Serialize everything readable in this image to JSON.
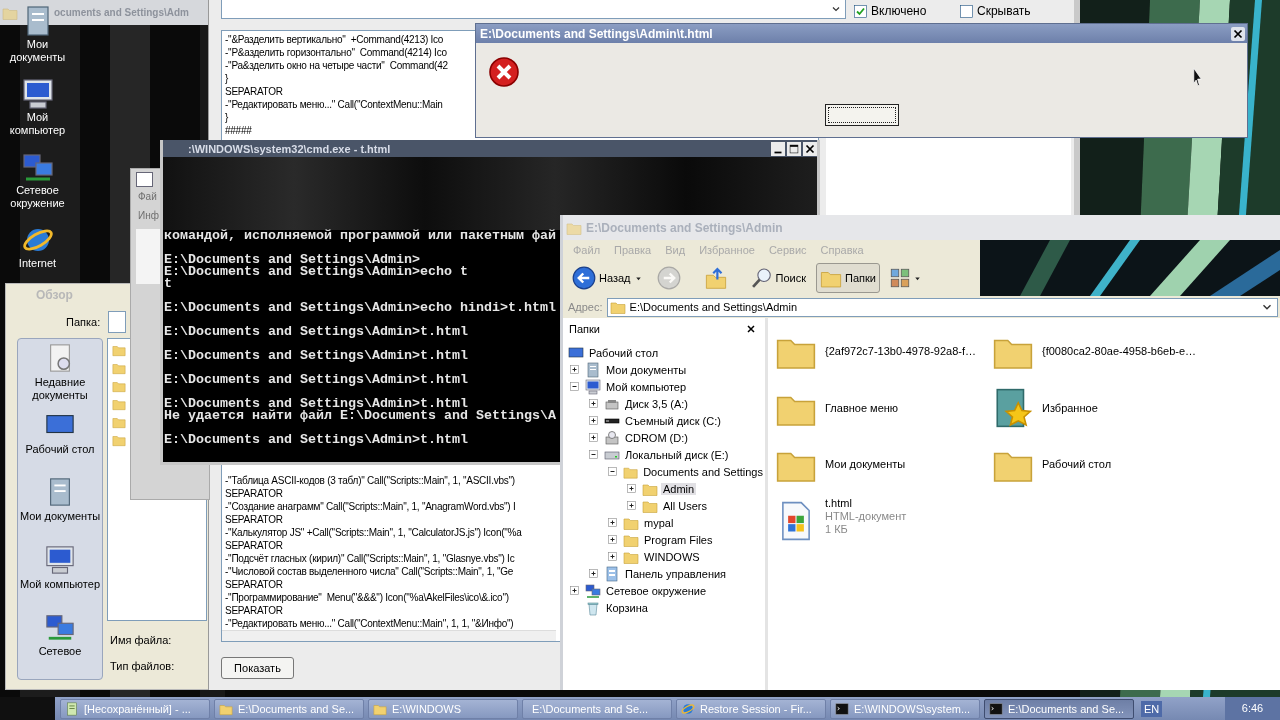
{
  "ghost_window": {
    "title": "ocuments and Settings\\Adm"
  },
  "desktop_icons": [
    {
      "label": "Мои документы",
      "kind": "documents"
    },
    {
      "label": "Мой компьютер",
      "kind": "computer"
    },
    {
      "label": "Сетевое окружение",
      "kind": "network"
    },
    {
      "label": "Internet",
      "kind": "browser"
    }
  ],
  "editor": {
    "toggles": [
      {
        "label": "Включено",
        "checked": true
      },
      {
        "label": "Скрывать",
        "checked": false
      }
    ],
    "code_top": [
      "-\"&Разделить вертикально\"  +Command(4213) Ico",
      "-\"P&азделить горизонтально\"  Command(4214) Ico",
      "-\"Ра&зделить окно на четыре части\"  Command(42",
      "}",
      "SEPARATOR",
      "-\"Редактировать меню...\" Call(\"ContextMenu::Main",
      "}",
      "#####"
    ],
    "code_bottom": [
      "-\"Таблица ASCII-кодов (3 табл)\" Call(\"Scripts::Main\", 1, \"ASCII.vbs\")",
      "SEPARATOR",
      "-\"Создание анаграмм\" Call(\"Scripts::Main\", 1, \"AnagramWord.vbs\") I",
      "SEPARATOR",
      "-\"Калькулятор JS\" +Call(\"Scripts::Main\", 1, \"CalculatorJS.js\") Icon(\"%a",
      "SEPARATOR",
      "-\"Подсчёт гласных (кирил)\" Call(\"Scripts::Main\", 1, \"Glasnye.vbs\") Ic",
      "-\"Числовой состав выделенного числа\" Call(\"Scripts::Main\", 1, \"Ge",
      "SEPARATOR",
      "-\"Программирование\"  Menu(\"&&&\") Icon(\"%a\\AkelFiles\\ico\\&.ico\")",
      "SEPARATOR",
      "-\"Редактировать меню...\" Call(\"ContextMenu::Main\", 1, 1, \"&Инфо\")"
    ],
    "button": "Показать"
  },
  "back_window": {
    "menu": [
      "Фай",
      "Инф"
    ]
  },
  "browse_dialog": {
    "title": "Обзор",
    "folder_label": "Папка:",
    "places": [
      {
        "label": "Недавние документы",
        "kind": "recent"
      },
      {
        "label": "Рабочий стол",
        "kind": "desktop"
      },
      {
        "label": "Мои документы",
        "kind": "documents"
      },
      {
        "label": "Мой компьютер",
        "kind": "computer"
      },
      {
        "label": "Сетевое",
        "kind": "network"
      }
    ],
    "file_name_label": "Имя файла:",
    "file_type_label": "Тип файлов:"
  },
  "console": {
    "title": ":\\WINDOWS\\system32\\cmd.exe - t.html",
    "blocks": [
      [
        "командой, исполняемой программой или пакетным фай"
      ],
      [
        "E:\\Documents and Settings\\Admin>",
        "E:\\Documents and Settings\\Admin>echo t",
        "t"
      ],
      [
        "E:\\Documents and Settings\\Admin>echo hindi>t.html"
      ],
      [
        "E:\\Documents and Settings\\Admin>t.html"
      ],
      [
        "E:\\Documents and Settings\\Admin>t.html"
      ],
      [
        "E:\\Documents and Settings\\Admin>t.html"
      ],
      [
        "E:\\Documents and Settings\\Admin>t.html",
        "Не удается найти файл E:\\Documents and Settings\\A"
      ],
      [
        "E:\\Documents and Settings\\Admin>t.html"
      ]
    ]
  },
  "error_dialog": {
    "title": "E:\\Documents and Settings\\Admin\\t.html"
  },
  "explorer": {
    "title": "E:\\Documents and Settings\\Admin",
    "menu": [
      "Файл",
      "Правка",
      "Вид",
      "Избранное",
      "Сервис",
      "Справка"
    ],
    "toolbar": [
      {
        "label": "Назад",
        "kind": "back",
        "pressed": false,
        "disabled": false
      },
      {
        "kind": "forward",
        "pressed": false,
        "disabled": true
      },
      {
        "kind": "up",
        "pressed": false,
        "disabled": false
      },
      {
        "label": "Поиск",
        "kind": "search",
        "pressed": false,
        "disabled": false
      },
      {
        "label": "Папки",
        "kind": "folders",
        "pressed": true,
        "disabled": false
      },
      {
        "kind": "views",
        "pressed": false,
        "disabled": false
      }
    ],
    "address_label": "Адрес:",
    "address": "E:\\Documents and Settings\\Admin",
    "folders_title": "Папки",
    "tree": [
      {
        "label": "Рабочий стол",
        "kind": "desktop",
        "selected": false,
        "children": [
          {
            "label": "Мои документы",
            "kind": "documents",
            "expanded": false,
            "selected": false
          },
          {
            "label": "Мой компьютер",
            "kind": "computer",
            "expanded": true,
            "selected": false,
            "children": [
              {
                "label": "Диск 3,5 (A:)",
                "kind": "floppy",
                "expanded": false,
                "selected": false
              },
              {
                "label": "Съемный диск (C:)",
                "kind": "removable",
                "expanded": false,
                "selected": false
              },
              {
                "label": "CDROM (D:)",
                "kind": "cdrom",
                "expanded": false,
                "selected": false
              },
              {
                "label": "Локальный диск (E:)",
                "kind": "disk",
                "expanded": true,
                "selected": false,
                "children": [
                  {
                    "label": "Documents and Settings",
                    "kind": "folder",
                    "expanded": true,
                    "selected": false,
                    "children": [
                      {
                        "label": "Admin",
                        "kind": "folder",
                        "expanded": false,
                        "selected": true
                      },
                      {
                        "label": "All Users",
                        "kind": "folder",
                        "expanded": false,
                        "selected": false
                      }
                    ]
                  },
                  {
                    "label": "mypal",
                    "kind": "folder",
                    "expanded": false,
                    "selected": false
                  },
                  {
                    "label": "Program Files",
                    "kind": "folder",
                    "expanded": false,
                    "selected": false
                  },
                  {
                    "label": "WINDOWS",
                    "kind": "folder",
                    "expanded": false,
                    "selected": false
                  }
                ]
              },
              {
                "label": "Панель управления",
                "kind": "control",
                "expanded": false,
                "selected": false
              }
            ]
          },
          {
            "label": "Сетевое окружение",
            "kind": "network",
            "expanded": false,
            "selected": false
          },
          {
            "label": "Корзина",
            "kind": "recycle",
            "selected": false
          }
        ]
      }
    ],
    "items": [
      {
        "name": "{2af972c7-13b0-4978-92a8-f…",
        "kind": "folder"
      },
      {
        "name": "{f0080ca2-80ae-4958-b6eb-e…",
        "kind": "folder"
      },
      {
        "name": "Главное меню",
        "kind": "folder"
      },
      {
        "name": "Избранное",
        "kind": "favorites"
      },
      {
        "name": "Мои документы",
        "kind": "folder"
      },
      {
        "name": "Рабочий стол",
        "kind": "folder"
      },
      {
        "name": "t.html",
        "kind": "html",
        "type": "HTML-документ",
        "size": "1 КБ"
      }
    ]
  },
  "taskbar": {
    "buttons": [
      {
        "label": "[Несохранённый] - ...",
        "kind": "editor",
        "selected": false
      },
      {
        "label": "E:\\Documents and Se...",
        "kind": "folder",
        "selected": false
      },
      {
        "label": "E:\\WINDOWS",
        "kind": "folder",
        "selected": false
      },
      {
        "label": "E:\\Documents and Se...",
        "kind": "plain",
        "selected": false
      },
      {
        "label": "Restore Session - Fir...",
        "kind": "browser",
        "selected": false
      },
      {
        "label": "E:\\WINDOWS\\system...",
        "kind": "console",
        "selected": false
      },
      {
        "label": "E:\\Documents and Se...",
        "kind": "console",
        "selected": true
      }
    ],
    "language": "EN",
    "clock": "6:46"
  }
}
